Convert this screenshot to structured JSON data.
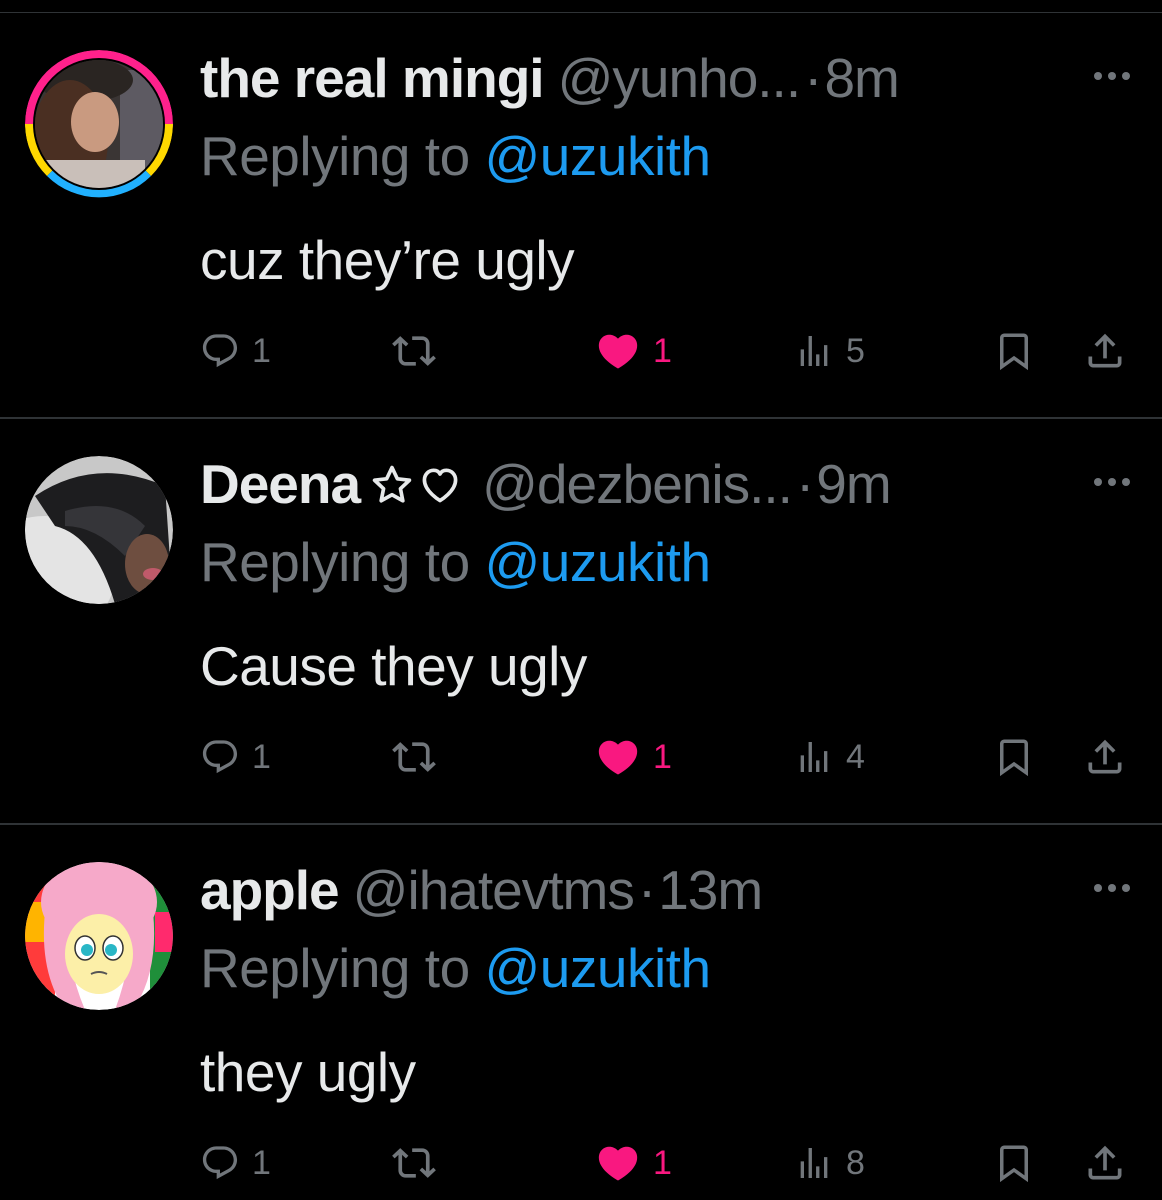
{
  "colors": {
    "background": "#000000",
    "primary_text": "#e7e9ea",
    "secondary_text": "#71767b",
    "mention": "#1d9bf0",
    "like": "#f91880",
    "divider": "#2f3336"
  },
  "tweets": [
    {
      "display_name": "the real mingi",
      "handle": "@yunho...",
      "separator": "·",
      "time": "8m",
      "replying_label": "Replying to",
      "replying_to": "@uzukith",
      "text": "cuz they’re ugly",
      "replies": "1",
      "likes": "1",
      "views": "5",
      "liked": true,
      "avatar": "avatar-photo-pride-ring"
    },
    {
      "display_name": "Deena",
      "name_icons": [
        "star-outline-icon",
        "heart-outline-icon"
      ],
      "handle": "@dezbenis...",
      "separator": "·",
      "time": "9m",
      "replying_label": "Replying to",
      "replying_to": "@uzukith",
      "text": "Cause they ugly",
      "replies": "1",
      "likes": "1",
      "views": "4",
      "liked": true,
      "avatar": "avatar-photo-dark-hair"
    },
    {
      "display_name": "apple",
      "handle": "@ihatevtms",
      "separator": "·",
      "time": "13m",
      "replying_label": "Replying to",
      "replying_to": "@uzukith",
      "text": "they ugly",
      "replies": "1",
      "likes": "1",
      "views": "8",
      "liked": true,
      "avatar": "avatar-pink-pony-cartoon"
    }
  ]
}
